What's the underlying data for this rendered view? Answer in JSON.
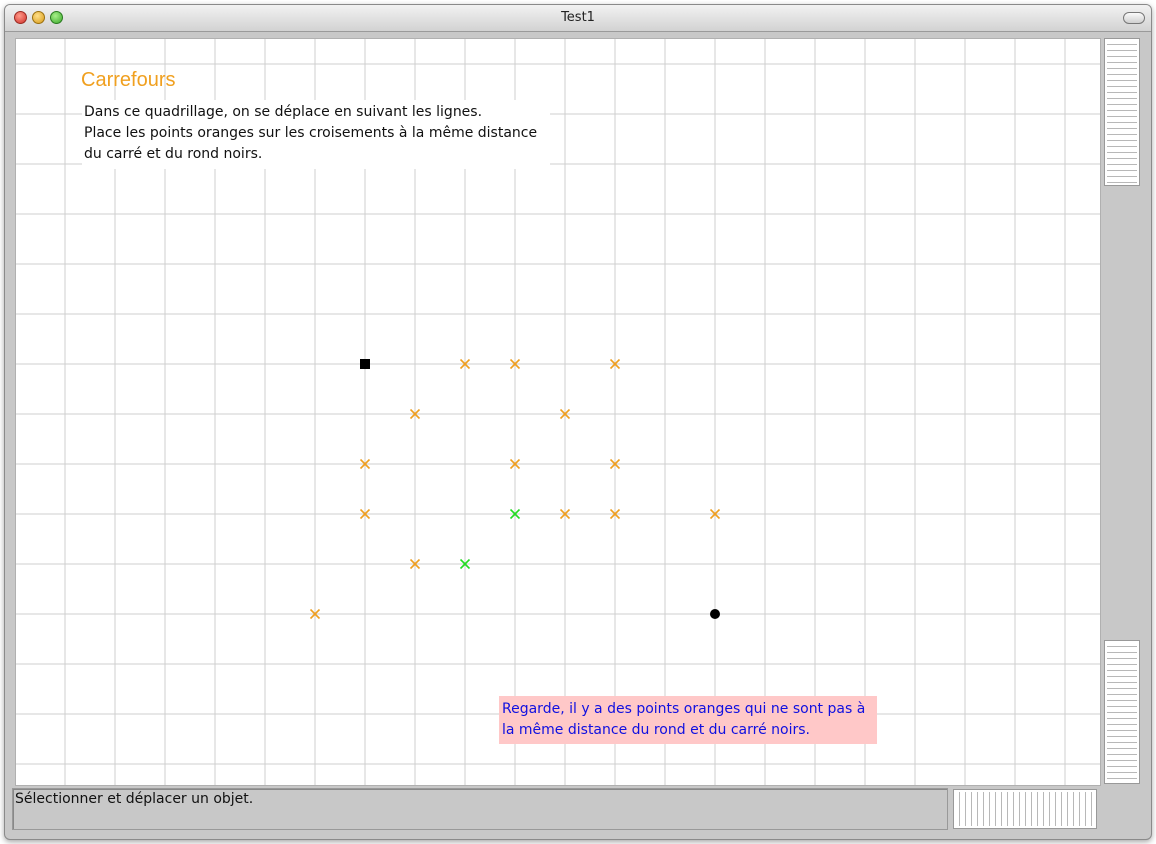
{
  "window": {
    "title": "Test1"
  },
  "exercise": {
    "heading": "Carrefours",
    "instructions": [
      "Dans ce quadrillage, on se déplace en suivant les lignes.",
      "Place les points oranges  sur les croisements à la même distance",
      "du carré et du rond noirs."
    ],
    "feedback": [
      "Regarde, il y a des points oranges qui ne sont pas à",
      "la même distance du rond et du carré noirs."
    ]
  },
  "status": {
    "text": "Sélectionner et déplacer un objet."
  },
  "colors": {
    "orange": "#f0a020",
    "green": "#22dd22",
    "black": "#000000",
    "feedback_bg": "#ffc8c8",
    "feedback_text": "#1010e0"
  },
  "grid": {
    "square": {
      "col": 6,
      "row": 6
    },
    "circle": {
      "col": 13,
      "row": 11
    },
    "orange_crosses": [
      {
        "col": 8,
        "row": 6
      },
      {
        "col": 9,
        "row": 6
      },
      {
        "col": 11,
        "row": 6
      },
      {
        "col": 7,
        "row": 7
      },
      {
        "col": 10,
        "row": 7
      },
      {
        "col": 6,
        "row": 8
      },
      {
        "col": 9,
        "row": 8
      },
      {
        "col": 11,
        "row": 8
      },
      {
        "col": 6,
        "row": 9
      },
      {
        "col": 10,
        "row": 9
      },
      {
        "col": 11,
        "row": 9
      },
      {
        "col": 13,
        "row": 9
      },
      {
        "col": 7,
        "row": 10
      },
      {
        "col": 5,
        "row": 11
      }
    ],
    "green_crosses": [
      {
        "col": 9,
        "row": 9
      },
      {
        "col": 8,
        "row": 10
      }
    ]
  }
}
